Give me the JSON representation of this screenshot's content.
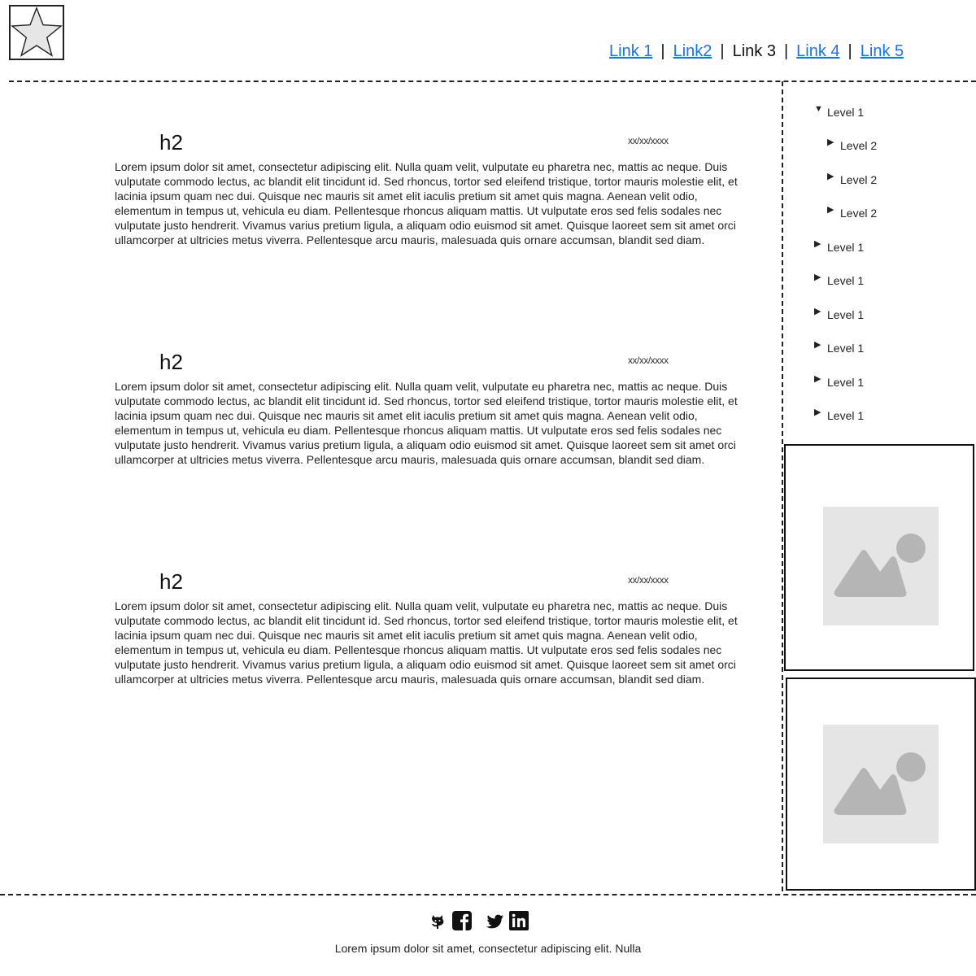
{
  "nav": {
    "links": [
      {
        "label": "Link 1",
        "current": false
      },
      {
        "label": "Link2",
        "current": false
      },
      {
        "label": "Link 3",
        "current": true
      },
      {
        "label": "Link 4",
        "current": false
      },
      {
        "label": "Link 5",
        "current": false
      }
    ],
    "separator": "|"
  },
  "articles": [
    {
      "heading": "h2",
      "date": "xx/xx/xxxx",
      "body": "Lorem ipsum dolor sit amet, consectetur adipiscing elit. Nulla quam velit, vulputate eu pharetra nec, mattis ac neque. Duis vulputate commodo lectus, ac blandit elit tincidunt id. Sed rhoncus, tortor sed eleifend tristique, tortor mauris molestie elit, et lacinia ipsum quam nec dui. Quisque nec mauris sit amet elit iaculis pretium sit amet quis magna. Aenean velit odio, elementum in tempus ut, vehicula eu diam. Pellentesque rhoncus aliquam mattis. Ut vulputate eros sed felis sodales nec vulputate justo hendrerit. Vivamus varius pretium ligula, a aliquam odio euismod sit amet. Quisque laoreet sem sit amet orci ullamcorper at ultricies metus viverra. Pellentesque arcu mauris, malesuada quis ornare accumsan, blandit sed diam."
    },
    {
      "heading": "h2",
      "date": "xx/xx/xxxx",
      "body": "Lorem ipsum dolor sit amet, consectetur adipiscing elit. Nulla quam velit, vulputate eu pharetra nec, mattis ac neque. Duis vulputate commodo lectus, ac blandit elit tincidunt id. Sed rhoncus, tortor sed eleifend tristique, tortor mauris molestie elit, et lacinia ipsum quam nec dui. Quisque nec mauris sit amet elit iaculis pretium sit amet quis magna. Aenean velit odio, elementum in tempus ut, vehicula eu diam. Pellentesque rhoncus aliquam mattis. Ut vulputate eros sed felis sodales nec vulputate justo hendrerit. Vivamus varius pretium ligula, a aliquam odio euismod sit amet. Quisque laoreet sem sit amet orci ullamcorper at ultricies metus viverra. Pellentesque arcu mauris, malesuada quis ornare accumsan, blandit sed diam."
    },
    {
      "heading": "h2",
      "date": "xx/xx/xxxx",
      "body": "Lorem ipsum dolor sit amet, consectetur adipiscing elit. Nulla quam velit, vulputate eu pharetra nec, mattis ac neque. Duis vulputate commodo lectus, ac blandit elit tincidunt id. Sed rhoncus, tortor sed eleifend tristique, tortor mauris molestie elit, et lacinia ipsum quam nec dui. Quisque nec mauris sit amet elit iaculis pretium sit amet quis magna. Aenean velit odio, elementum in tempus ut, vehicula eu diam. Pellentesque rhoncus aliquam mattis. Ut vulputate eros sed felis sodales nec vulputate justo hendrerit. Vivamus varius pretium ligula, a aliquam odio euismod sit amet. Quisque laoreet sem sit amet orci ullamcorper at ultricies metus viverra. Pellentesque arcu mauris, malesuada quis ornare accumsan, blandit sed diam."
    }
  ],
  "tree": [
    {
      "label": "Level 1",
      "expanded": true
    },
    {
      "label": "Level 2",
      "expanded": false
    },
    {
      "label": "Level 2",
      "expanded": false
    },
    {
      "label": "Level 2",
      "expanded": false
    },
    {
      "label": "Level 1",
      "expanded": false
    },
    {
      "label": "Level 1",
      "expanded": false
    },
    {
      "label": "Level 1",
      "expanded": false
    },
    {
      "label": "Level 1",
      "expanded": false
    },
    {
      "label": "Level 1",
      "expanded": false
    },
    {
      "label": "Level 1",
      "expanded": false
    }
  ],
  "social_icons": [
    "github-icon",
    "facebook-icon",
    "twitter-icon",
    "linkedin-icon"
  ],
  "footer": {
    "text": "Lorem ipsum dolor sit amet, consectetur adipiscing elit. Nulla"
  },
  "colors": {
    "link": "#1a73e8",
    "placeholder_bg": "#e5e5e5",
    "placeholder_fg": "#b5b5b5"
  }
}
